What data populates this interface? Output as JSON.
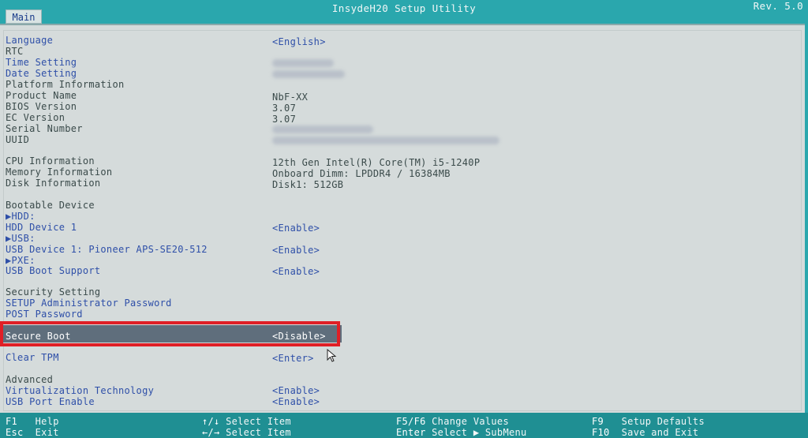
{
  "window": {
    "title": "InsydeH20 Setup Utility",
    "rev": "Rev. 5.0",
    "tab": "Main"
  },
  "settings": [
    {
      "label": "Language",
      "value": "<English>"
    },
    {
      "label": "RTC",
      "value": ""
    },
    {
      "label": "Time Setting",
      "value": ""
    },
    {
      "label": "Date Setting",
      "value": ""
    },
    {
      "label": "Platform Information",
      "value": ""
    },
    {
      "label": "Product Name",
      "value": "NbF-XX"
    },
    {
      "label": "BIOS Version",
      "value": "3.07"
    },
    {
      "label": "EC Version",
      "value": "3.07"
    },
    {
      "label": "Serial Number",
      "value": ""
    },
    {
      "label": "UUID",
      "value": ""
    },
    {
      "label": "CPU Information",
      "value": "12th Gen Intel(R) Core(TM) i5-1240P"
    },
    {
      "label": "Memory Information",
      "value": "Onboard Dimm: LPDDR4 / 16384MB"
    },
    {
      "label": "Disk Information",
      "value": "Disk1:  512GB"
    },
    {
      "label": "Bootable Device",
      "value": ""
    },
    {
      "label": "▶HDD:",
      "value": ""
    },
    {
      "label": "HDD Device 1",
      "value": "<Enable>"
    },
    {
      "label": "▶USB:",
      "value": ""
    },
    {
      "label": "USB Device 1: Pioneer APS-SE20-512",
      "value": "<Enable>"
    },
    {
      "label": "▶PXE:",
      "value": ""
    },
    {
      "label": "USB Boot Support",
      "value": "<Enable>"
    },
    {
      "label": "Security Setting",
      "value": ""
    },
    {
      "label": "SETUP Administrator Password",
      "value": ""
    },
    {
      "label": "POST Password",
      "value": ""
    },
    {
      "label": "Secure Boot",
      "value": "<Disable>"
    },
    {
      "label": "Clear TPM",
      "value": "<Enter>"
    },
    {
      "label": "Advanced",
      "value": ""
    },
    {
      "label": "Virtualization Technology",
      "value": "<Enable>"
    },
    {
      "label": "USB Port Enable",
      "value": "<Enable>"
    }
  ],
  "footer": {
    "f1_key": "F1",
    "f1_text": "Help",
    "esc_key": "Esc",
    "esc_text": "Exit",
    "updown_key": "↑/↓",
    "updown_text": "Select Item",
    "leftright_key": "←/→",
    "leftright_text": "Select Item",
    "f5f6_key": "F5/F6",
    "f5f6_text": "Change Values",
    "enter_key": "Enter",
    "enter_text": "Select ▶ SubMenu",
    "f9_key": "F9",
    "f9_text": "Setup Defaults",
    "f10_key": "F10",
    "f10_text": "Save and Exit"
  },
  "colors": {
    "frame": "#1f8f93",
    "panel": "#d5dbdb",
    "item_blue": "#2e4fa8",
    "highlight_box": "#e01f26"
  }
}
